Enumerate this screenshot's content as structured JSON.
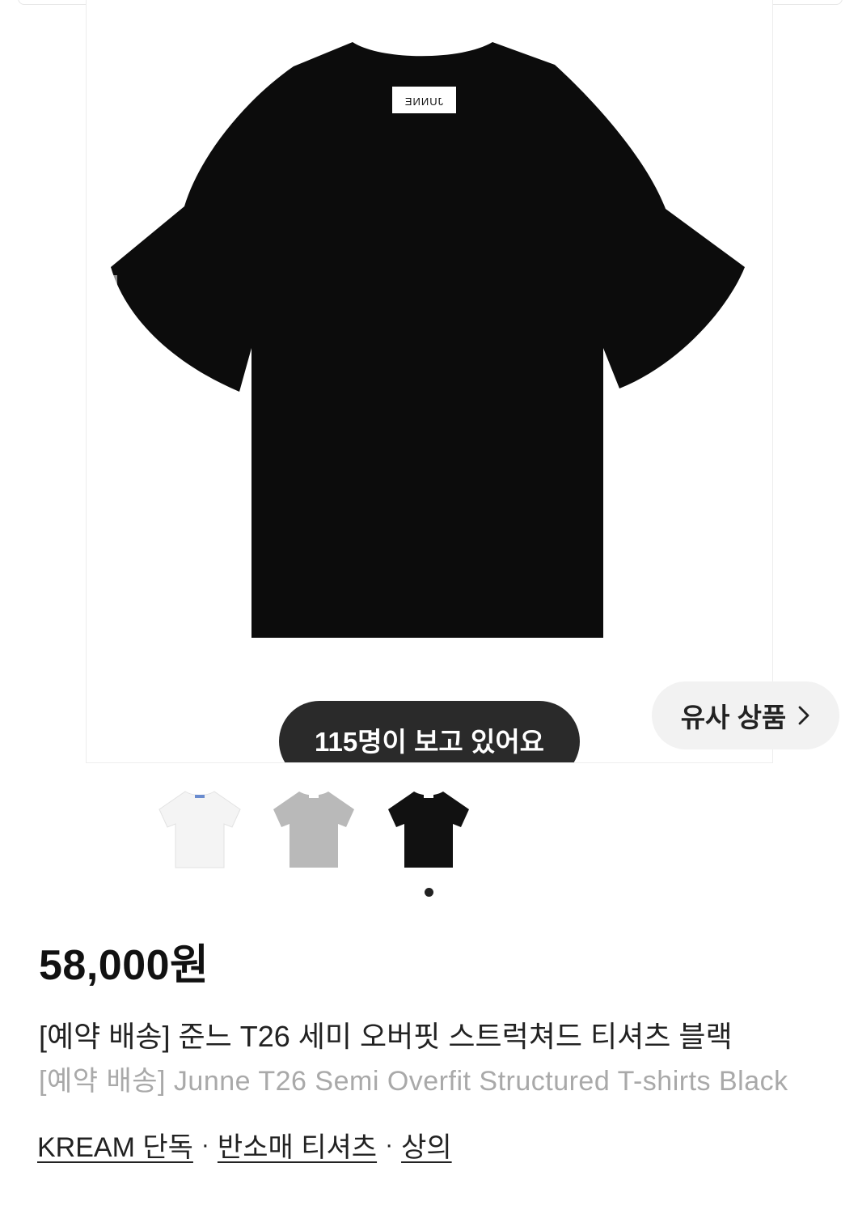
{
  "product": {
    "viewers": "115명이 보고 있어요",
    "similar_label": "유사 상품",
    "label_text": "JUNNE",
    "price": "58,000원",
    "title_ko": "[예약 배송] 준느 T26 세미 오버핏 스트럭쳐드 티셔츠 블랙",
    "title_en": "[예약 배송] Junne T26 Semi Overfit Structured T-shirts Black"
  },
  "thumbnails": [
    {
      "name": "white",
      "color": "#f4f4f4"
    },
    {
      "name": "gray",
      "color": "#b9b9b9"
    },
    {
      "name": "black",
      "color": "#111111"
    }
  ],
  "tags": [
    "KREAM 단독",
    "반소매 티셔츠",
    "상의"
  ],
  "colors": {
    "shirt": "#0c0c0c",
    "pill_bg": "#2a2a2a",
    "similar_bg": "#f2f2f2"
  }
}
